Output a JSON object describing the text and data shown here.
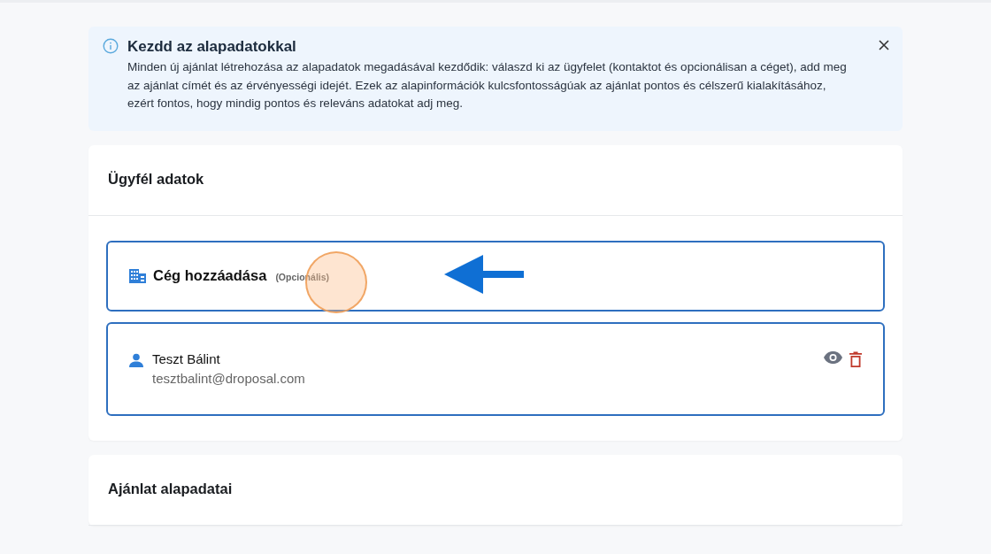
{
  "alert": {
    "title": "Kezdd az alapadatokkal",
    "text": "Minden új ajánlat létrehozása az alapadatok megadásával kezdődik: válaszd ki az ügyfelet (kontaktot és opcionálisan a céget), add meg az ajánlat címét és az érvényességi idejét. Ezek az alapinformációk kulcsfontosságúak az ajánlat pontos és célszerű kialakításához, ezért fontos, hogy mindig pontos és releváns adatokat adj meg."
  },
  "sections": [
    {
      "title": "Ügyfél adatok",
      "items": [
        {
          "kind": "add-company",
          "label": "Cég hozzáadása",
          "hint": "(Opcionális)"
        },
        {
          "kind": "contact",
          "name": "Teszt Bálint",
          "email": "tesztbalint@droposal.com"
        }
      ]
    },
    {
      "title": "Ajánlat alapadatai"
    }
  ]
}
